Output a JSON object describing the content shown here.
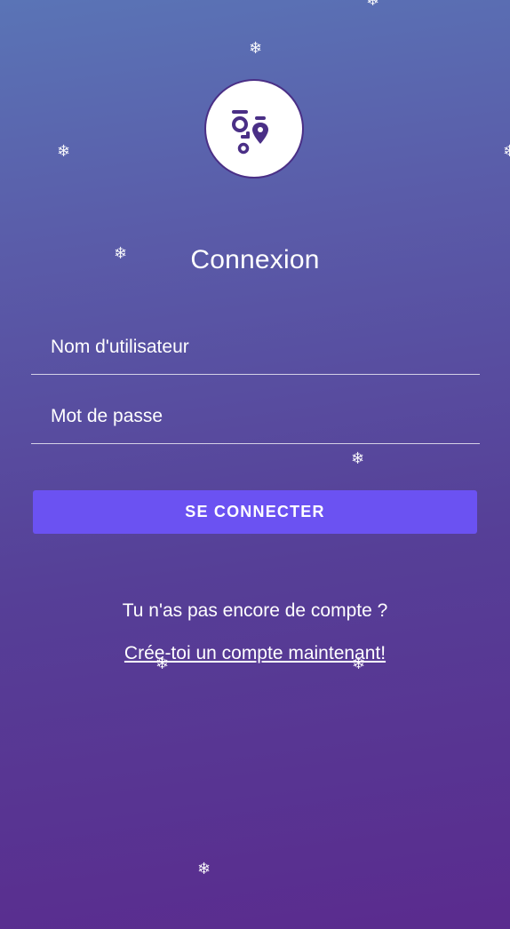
{
  "login": {
    "title": "Connexion",
    "username_placeholder": "Nom d'utilisateur",
    "password_placeholder": "Mot de passe",
    "submit_label": "SE CONNECTER",
    "no_account_text": "Tu n'as pas encore de compte ?",
    "signup_link": "Crée-toi un compte maintenant!"
  },
  "colors": {
    "gradient_top": "#5a74b6",
    "gradient_bottom": "#5a2b8e",
    "button": "#6b52f2",
    "logo_mark": "#4a2f86"
  },
  "decorations": {
    "icon": "snowflake-icon",
    "glyph": "❄"
  }
}
